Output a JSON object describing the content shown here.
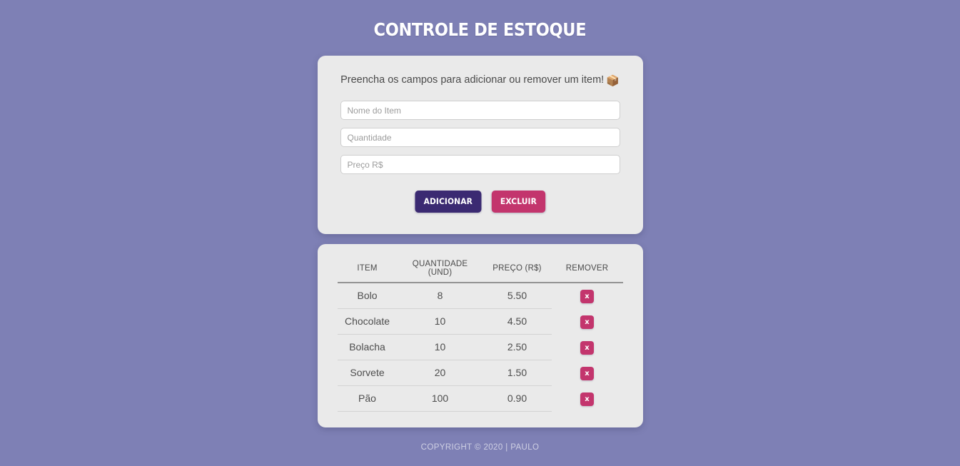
{
  "header": {
    "title": "CONTROLE DE ESTOQUE"
  },
  "form": {
    "intro_text": "Preencha os campos para adicionar ou remover um item!",
    "intro_emoji": "📦",
    "intro_emoji_name": "package-box-emoji",
    "fields": [
      {
        "name": "item-name-input",
        "placeholder": "Nome do Item",
        "value": ""
      },
      {
        "name": "quantity-input",
        "placeholder": "Quantidade",
        "value": ""
      },
      {
        "name": "price-input",
        "placeholder": "Preço R$",
        "value": ""
      }
    ],
    "buttons": {
      "add_label": "ADICIONAR",
      "delete_label": "EXCLUIR"
    }
  },
  "table": {
    "headers": [
      "ITEM",
      "QUANTIDADE (UND)",
      "PREÇO (R$)",
      "REMOVER"
    ],
    "remove_label": "x",
    "rows": [
      {
        "item": "Bolo",
        "quantidade": "8",
        "preco": "5.50"
      },
      {
        "item": "Chocolate",
        "quantidade": "10",
        "preco": "4.50"
      },
      {
        "item": "Bolacha",
        "quantidade": "10",
        "preco": "2.50"
      },
      {
        "item": "Sorvete",
        "quantidade": "20",
        "preco": "1.50"
      },
      {
        "item": "Pão",
        "quantidade": "100",
        "preco": "0.90"
      }
    ]
  },
  "footer": {
    "text": "COPYRIGHT © 2020 | PAULO"
  },
  "colors": {
    "background": "#7e80b5",
    "card": "#eaeaea",
    "accent_add": "#3b2a72",
    "accent_delete": "#c3356d",
    "title": "#ffffff"
  }
}
